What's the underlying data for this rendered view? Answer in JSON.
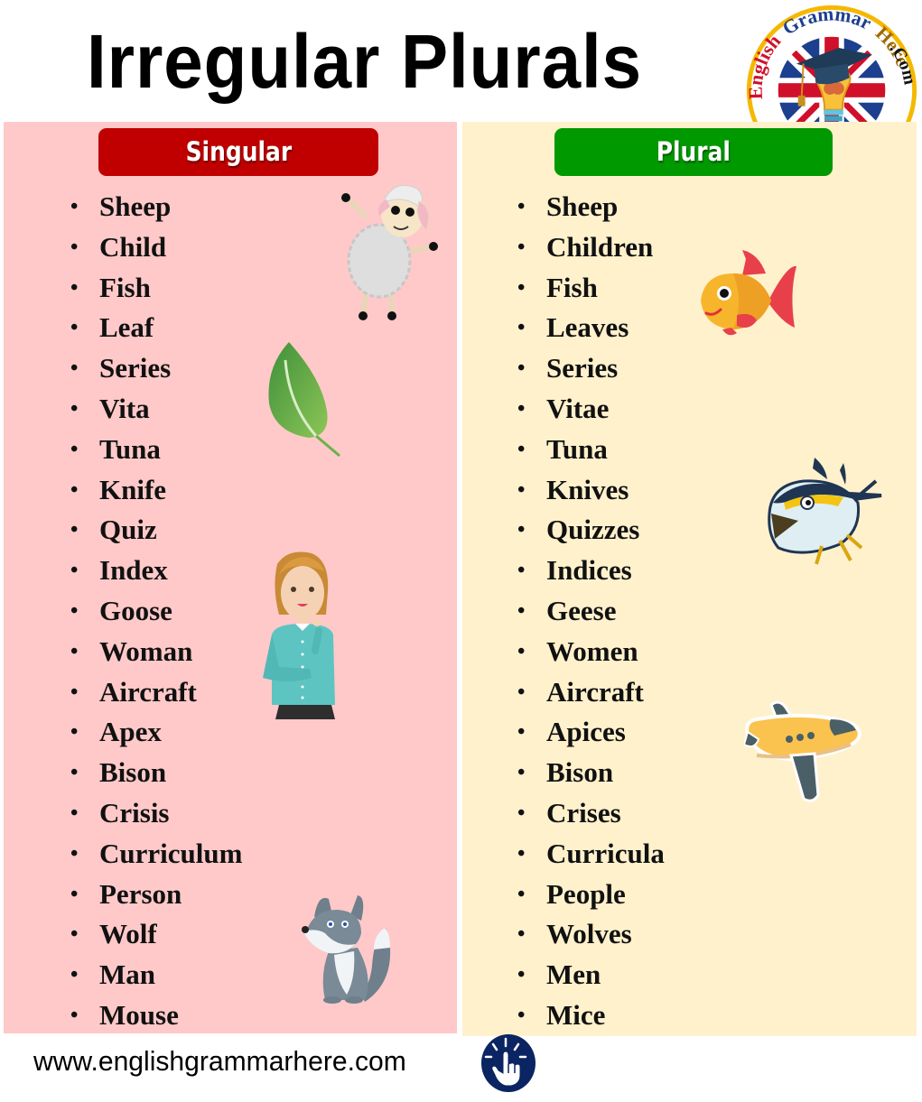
{
  "title": "Irregular Plurals",
  "colors": {
    "singular_header": "#c00000",
    "plural_header": "#009900",
    "singular_panel": "#ffc9c9",
    "plural_panel": "#fff1cc",
    "hand_icon_bg": "#0b2462"
  },
  "logo": {
    "text_english": "English",
    "text_grammar": "Grammar",
    "text_here": "Here",
    "text_com": ".Com"
  },
  "singular": {
    "header": "Singular",
    "items": [
      "Sheep",
      "Child",
      "Fish",
      "Leaf",
      "Series",
      "Vita",
      "Tuna",
      "Knife",
      "Quiz",
      "Index",
      "Goose",
      "Woman",
      "Aircraft",
      "Apex",
      "Bison",
      "Crisis",
      "Curriculum",
      "Person",
      "Wolf",
      "Man",
      "Mouse"
    ],
    "illustrations": [
      "sheep",
      "leaf",
      "woman",
      "wolf"
    ]
  },
  "plural": {
    "header": "Plural",
    "items": [
      "Sheep",
      "Children",
      "Fish",
      "Leaves",
      "Series",
      "Vitae",
      "Tuna",
      "Knives",
      "Quizzes",
      "Indices",
      "Geese",
      "Women",
      "Aircraft",
      "Apices",
      "Bison",
      "Crises",
      "Curricula",
      "People",
      "Wolves",
      "Men",
      "Mice"
    ],
    "illustrations": [
      "goldfish",
      "tuna",
      "airplane"
    ]
  },
  "footer": {
    "url": "www.englishgrammarhere.com",
    "icon": "pointing-hand-icon"
  },
  "bullet": "•"
}
